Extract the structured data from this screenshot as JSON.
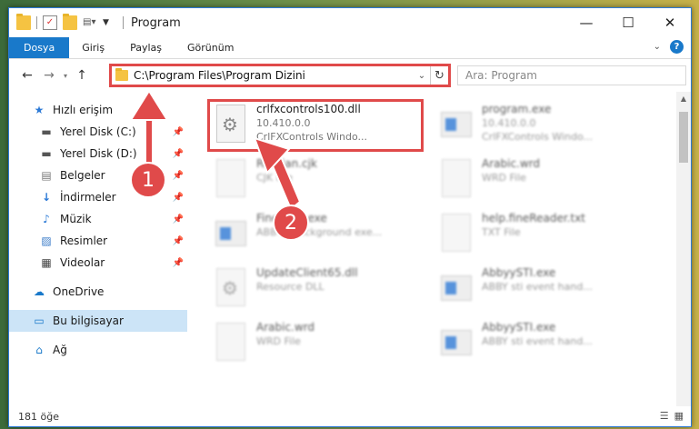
{
  "window": {
    "title": "Program"
  },
  "titlebar": {
    "minimize": "—",
    "maximize": "☐",
    "close": "✕"
  },
  "ribbon": {
    "tabs": [
      {
        "label": "Dosya",
        "active": true
      },
      {
        "label": "Giriş"
      },
      {
        "label": "Paylaş"
      },
      {
        "label": "Görünüm"
      }
    ],
    "help": "?"
  },
  "nav": {
    "back": "←",
    "forward": "→",
    "up": "↑",
    "address": "C:\\Program Files\\Program Dizini",
    "search_placeholder": "Ara: Program"
  },
  "sidebar": {
    "items": [
      {
        "label": "Hızlı erişim",
        "icon": "star-icon",
        "glyph": "★"
      },
      {
        "label": "Yerel Disk (C:)",
        "icon": "drive-icon",
        "glyph": "▬",
        "pinned": true
      },
      {
        "label": "Yerel Disk (D:)",
        "icon": "drive-icon",
        "glyph": "▬",
        "pinned": true
      },
      {
        "label": "Belgeler",
        "icon": "documents-icon",
        "glyph": "▤",
        "pinned": true
      },
      {
        "label": "İndirmeler",
        "icon": "downloads-icon",
        "glyph": "↓",
        "pinned": true
      },
      {
        "label": "Müzik",
        "icon": "music-icon",
        "glyph": "♪",
        "pinned": true
      },
      {
        "label": "Resimler",
        "icon": "pictures-icon",
        "glyph": "▨",
        "pinned": true
      },
      {
        "label": "Videolar",
        "icon": "videos-icon",
        "glyph": "▦",
        "pinned": true
      },
      {
        "label": "OneDrive",
        "icon": "cloud-icon",
        "glyph": "☁"
      },
      {
        "label": "Bu bilgisayar",
        "icon": "computer-icon",
        "glyph": "▭",
        "selected": true
      },
      {
        "label": "Ağ",
        "icon": "network-icon",
        "glyph": "⌂"
      }
    ]
  },
  "files": {
    "selected": {
      "name": "crlfxcontrols100.dll",
      "version": "10.410.0.0",
      "desc": "CrlFXControls Windo..."
    },
    "others": [
      {
        "name": "program.exe",
        "meta1": "10.410.0.0",
        "meta2": "CrlFXControls Windo..."
      },
      {
        "name": "Russian.cjk",
        "meta1": "CJK File"
      },
      {
        "name": "Arabic.wrd",
        "meta1": "WRD File"
      },
      {
        "name": "FineExec.exe",
        "meta1": "ABBYY Background exe..."
      },
      {
        "name": "help.fineReader.txt",
        "meta1": "TXT File"
      },
      {
        "name": "UpdateClient65.dll",
        "meta1": "Resource DLL"
      },
      {
        "name": "AbbyySTI.exe",
        "meta1": "ABBY sti event hand..."
      },
      {
        "name": "Arabic.wrd",
        "meta1": "WRD File"
      },
      {
        "name": "AbbyySTI.exe",
        "meta1": "ABBY sti event hand..."
      }
    ]
  },
  "status": {
    "count": "181 öğe"
  },
  "annotations": {
    "step1": "1",
    "step2": "2",
    "color": "#e04a4a"
  }
}
